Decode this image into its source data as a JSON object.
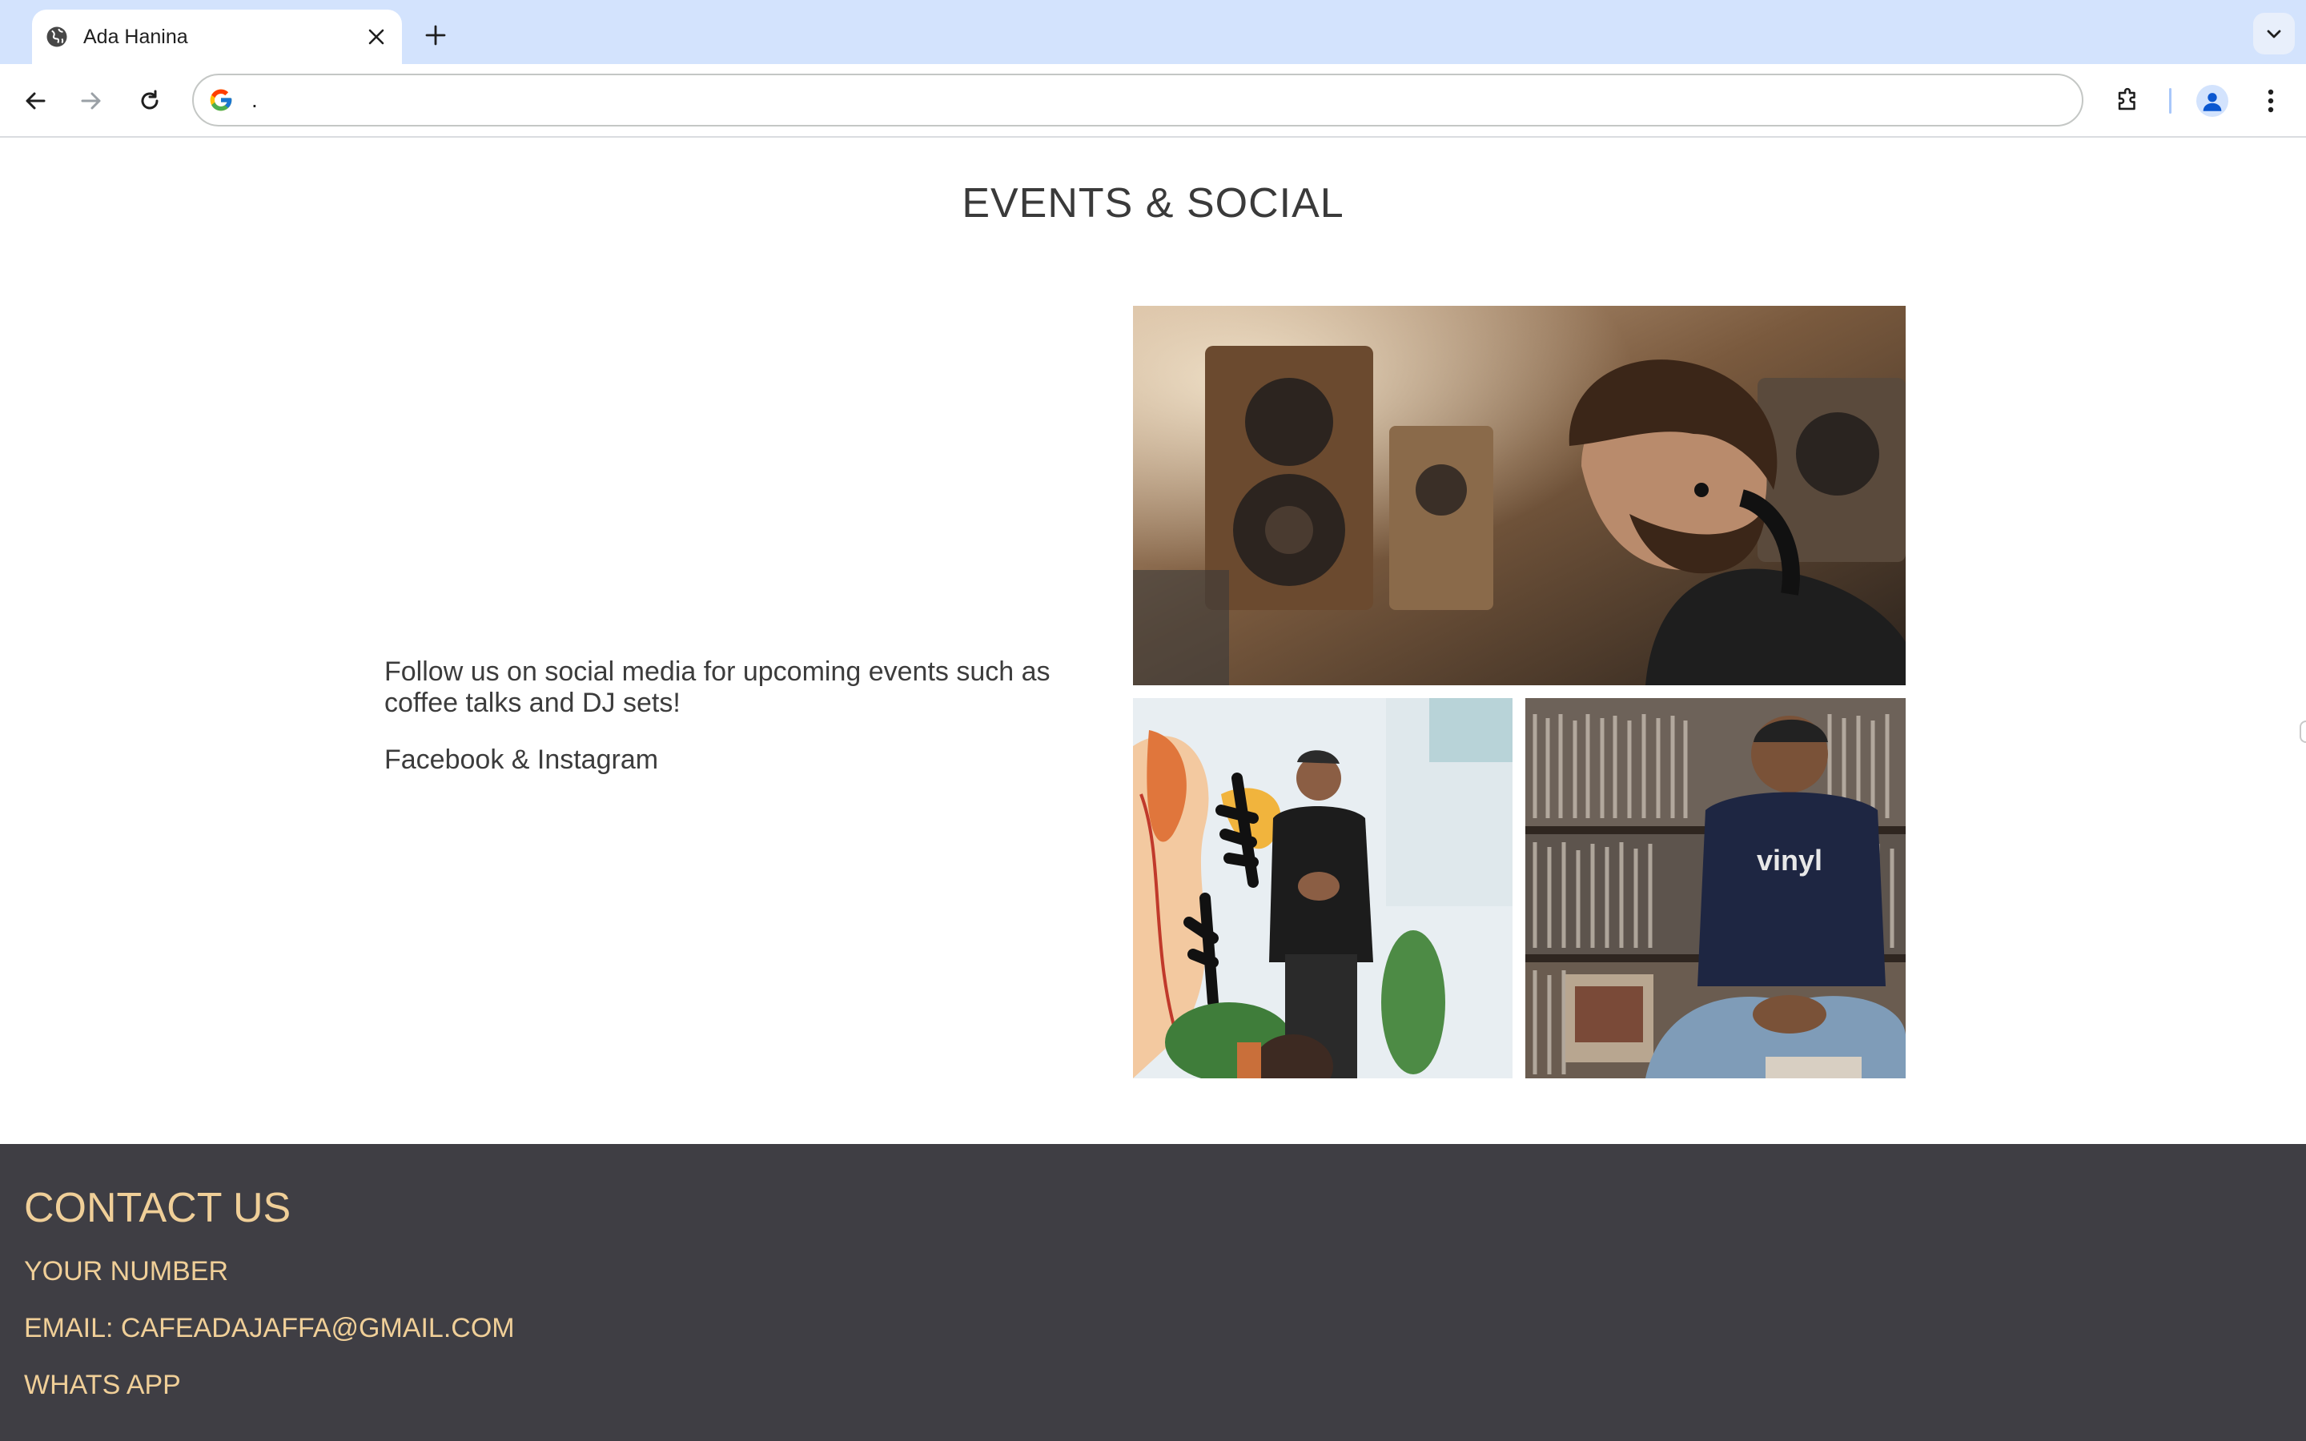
{
  "browser": {
    "tab_title": "Ada Hanina",
    "address_text": ".",
    "icons": {
      "tab_favicon": "globe-icon",
      "tab_close": "close-icon",
      "new_tab": "plus-icon",
      "tab_search": "chevron-down-icon",
      "back": "arrow-left-icon",
      "forward": "arrow-right-icon",
      "reload": "reload-icon",
      "search_engine": "google-g-icon",
      "extensions": "puzzle-icon",
      "profile": "person-icon",
      "menu": "kebab-menu-icon"
    }
  },
  "events": {
    "title": "EVENTS & SOCIAL",
    "description": "Follow us on social media for upcoming events such as coffee talks and DJ sets!",
    "social_links": "Facebook & Instagram",
    "photo_shirt_text": "vinyl"
  },
  "contact": {
    "title": "CONTACT US",
    "number": "YOUR NUMBER",
    "email": "EMAIL: CAFEADAJAFFA@GMAIL.COM",
    "whatsapp": "WHATS APP"
  },
  "colors": {
    "tabstrip": "#d3e3fd",
    "footer_bg": "#3f3e44",
    "footer_text": "#f0cf98",
    "title_text": "#3a3a3a"
  }
}
